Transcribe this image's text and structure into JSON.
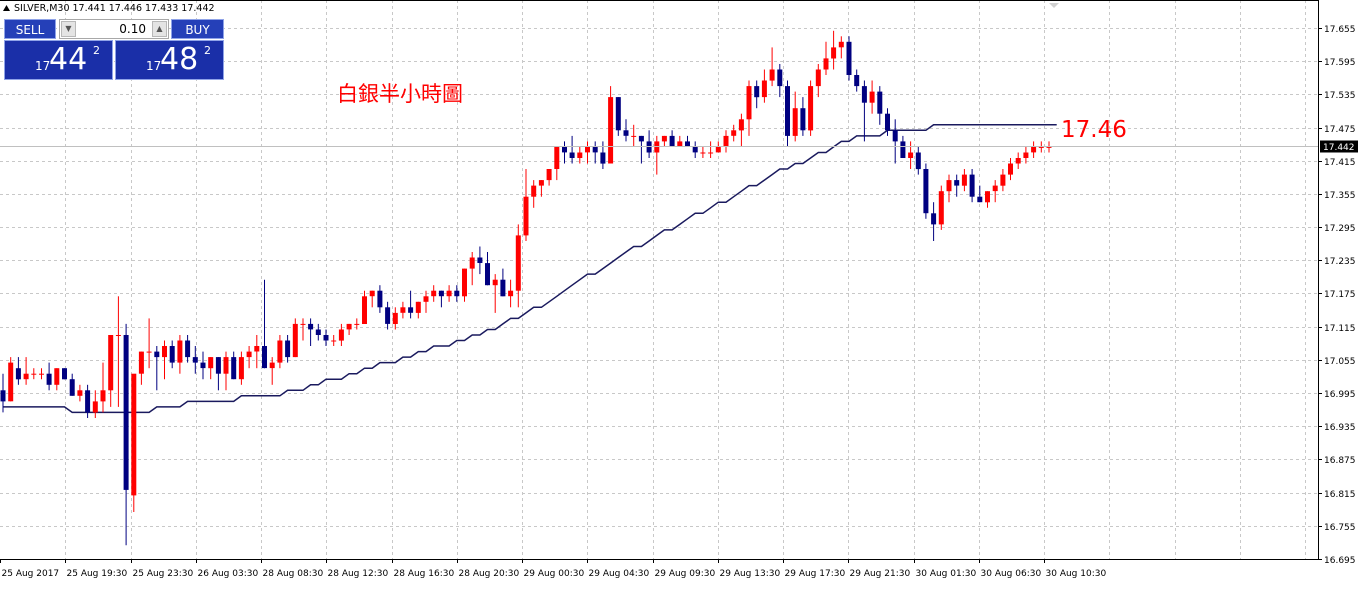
{
  "header": {
    "symbol_line": "SILVER,M30  17.441 17.446 17.433 17.442"
  },
  "trade_panel": {
    "sell_label": "SELL",
    "buy_label": "BUY",
    "lot_value": "0.10",
    "sell_quote": {
      "prefix": "17",
      "big": "44",
      "sup": "2"
    },
    "buy_quote": {
      "prefix": "17",
      "big": "48",
      "sup": "2"
    }
  },
  "annotations": {
    "chart_label": "白銀半小時圖",
    "level_label": "17.46"
  },
  "colors": {
    "bull": "#ff0000",
    "bear": "#000080",
    "ma_line": "#1a1a5e",
    "grid": "#c8c8c8",
    "annotation": "#ff0000",
    "current_price_bg": "#000000"
  },
  "chart_data": {
    "type": "candlestick",
    "title": "SILVER,M30",
    "ylim": [
      16.695,
      17.685
    ],
    "y_ticks": [
      "17.655",
      "17.595",
      "17.535",
      "17.475",
      "17.415",
      "17.355",
      "17.295",
      "17.235",
      "17.175",
      "17.115",
      "17.055",
      "16.995",
      "16.935",
      "16.875",
      "16.815",
      "16.755",
      "16.695"
    ],
    "x_ticks": [
      "25 Aug 2017",
      "25 Aug 19:30",
      "25 Aug 23:30",
      "26 Aug 03:30",
      "28 Aug 08:30",
      "28 Aug 12:30",
      "28 Aug 16:30",
      "28 Aug 20:30",
      "29 Aug 00:30",
      "29 Aug 04:30",
      "29 Aug 09:30",
      "29 Aug 13:30",
      "29 Aug 17:30",
      "29 Aug 21:30",
      "30 Aug 01:30",
      "30 Aug 06:30",
      "30 Aug 10:30"
    ],
    "current_price": 17.442,
    "current_price_label": "17.442",
    "ohlc": [
      [
        17.0,
        17.03,
        16.96,
        16.98
      ],
      [
        16.98,
        17.06,
        16.98,
        17.05
      ],
      [
        17.04,
        17.06,
        17.01,
        17.02
      ],
      [
        17.02,
        17.06,
        17.01,
        17.03
      ],
      [
        17.03,
        17.04,
        17.02,
        17.03
      ],
      [
        17.03,
        17.04,
        17.02,
        17.03
      ],
      [
        17.03,
        17.05,
        17.0,
        17.01
      ],
      [
        17.01,
        17.04,
        17.0,
        17.04
      ],
      [
        17.04,
        17.04,
        17.02,
        17.02
      ],
      [
        17.02,
        17.03,
        16.99,
        16.99
      ],
      [
        16.99,
        17.01,
        16.98,
        17.0
      ],
      [
        17.0,
        17.01,
        16.95,
        16.96
      ],
      [
        16.96,
        17.0,
        16.95,
        16.98
      ],
      [
        16.98,
        17.05,
        16.96,
        17.0
      ],
      [
        17.0,
        17.05,
        16.97,
        17.1
      ],
      [
        17.1,
        17.17,
        16.97,
        17.1
      ],
      [
        17.1,
        17.12,
        16.72,
        16.82
      ],
      [
        16.81,
        17.02,
        16.78,
        17.03
      ],
      [
        17.03,
        17.07,
        17.01,
        17.07
      ],
      [
        17.07,
        17.13,
        17.04,
        17.07
      ],
      [
        17.07,
        17.08,
        17.0,
        17.06
      ],
      [
        17.06,
        17.09,
        17.02,
        17.08
      ],
      [
        17.08,
        17.09,
        17.04,
        17.05
      ],
      [
        17.05,
        17.1,
        17.03,
        17.09
      ],
      [
        17.09,
        17.1,
        17.05,
        17.06
      ],
      [
        17.06,
        17.08,
        17.03,
        17.05
      ],
      [
        17.05,
        17.07,
        17.02,
        17.04
      ],
      [
        17.04,
        17.06,
        17.02,
        17.06
      ],
      [
        17.06,
        17.06,
        17.0,
        17.03
      ],
      [
        17.03,
        17.07,
        17.0,
        17.06
      ],
      [
        17.06,
        17.07,
        17.02,
        17.02
      ],
      [
        17.02,
        17.07,
        17.01,
        17.06
      ],
      [
        17.06,
        17.08,
        17.04,
        17.07
      ],
      [
        17.07,
        17.1,
        17.04,
        17.08
      ],
      [
        17.08,
        17.2,
        17.04,
        17.04
      ],
      [
        17.04,
        17.06,
        17.01,
        17.05
      ],
      [
        17.05,
        17.1,
        17.04,
        17.09
      ],
      [
        17.09,
        17.1,
        17.05,
        17.06
      ],
      [
        17.06,
        17.13,
        17.06,
        17.12
      ],
      [
        17.12,
        17.13,
        17.09,
        17.12
      ],
      [
        17.12,
        17.13,
        17.08,
        17.11
      ],
      [
        17.11,
        17.12,
        17.09,
        17.1
      ],
      [
        17.1,
        17.11,
        17.08,
        17.09
      ],
      [
        17.09,
        17.1,
        17.08,
        17.09
      ],
      [
        17.09,
        17.12,
        17.08,
        17.11
      ],
      [
        17.11,
        17.12,
        17.1,
        17.12
      ],
      [
        17.12,
        17.13,
        17.11,
        17.12
      ],
      [
        17.12,
        17.18,
        17.12,
        17.17
      ],
      [
        17.17,
        17.18,
        17.15,
        17.18
      ],
      [
        17.18,
        17.19,
        17.14,
        17.15
      ],
      [
        17.15,
        17.16,
        17.11,
        17.12
      ],
      [
        17.12,
        17.15,
        17.11,
        17.14
      ],
      [
        17.14,
        17.16,
        17.13,
        17.15
      ],
      [
        17.15,
        17.18,
        17.13,
        17.14
      ],
      [
        17.14,
        17.16,
        17.13,
        17.16
      ],
      [
        17.16,
        17.18,
        17.14,
        17.17
      ],
      [
        17.17,
        17.19,
        17.16,
        17.18
      ],
      [
        17.18,
        17.18,
        17.15,
        17.17
      ],
      [
        17.17,
        17.19,
        17.16,
        17.18
      ],
      [
        17.18,
        17.19,
        17.16,
        17.17
      ],
      [
        17.17,
        17.22,
        17.16,
        17.22
      ],
      [
        17.22,
        17.25,
        17.19,
        17.24
      ],
      [
        17.24,
        17.26,
        17.21,
        17.23
      ],
      [
        17.23,
        17.25,
        17.19,
        17.19
      ],
      [
        17.19,
        17.21,
        17.14,
        17.2
      ],
      [
        17.2,
        17.22,
        17.17,
        17.17
      ],
      [
        17.17,
        17.2,
        17.15,
        17.18
      ],
      [
        17.18,
        17.3,
        17.15,
        17.28
      ],
      [
        17.28,
        17.4,
        17.27,
        17.35
      ],
      [
        17.35,
        17.38,
        17.33,
        17.37
      ],
      [
        17.37,
        17.38,
        17.35,
        17.38
      ],
      [
        17.38,
        17.4,
        17.37,
        17.4
      ],
      [
        17.4,
        17.44,
        17.38,
        17.44
      ],
      [
        17.44,
        17.45,
        17.41,
        17.43
      ],
      [
        17.43,
        17.46,
        17.41,
        17.42
      ],
      [
        17.42,
        17.44,
        17.41,
        17.43
      ],
      [
        17.43,
        17.45,
        17.41,
        17.44
      ],
      [
        17.44,
        17.45,
        17.41,
        17.43
      ],
      [
        17.43,
        17.45,
        17.4,
        17.41
      ],
      [
        17.41,
        17.55,
        17.41,
        17.53
      ],
      [
        17.53,
        17.53,
        17.46,
        17.47
      ],
      [
        17.47,
        17.49,
        17.45,
        17.46
      ],
      [
        17.46,
        17.48,
        17.44,
        17.46
      ],
      [
        17.46,
        17.46,
        17.41,
        17.45
      ],
      [
        17.45,
        17.47,
        17.42,
        17.43
      ],
      [
        17.43,
        17.46,
        17.39,
        17.45
      ],
      [
        17.45,
        17.46,
        17.44,
        17.46
      ],
      [
        17.46,
        17.47,
        17.44,
        17.44
      ],
      [
        17.44,
        17.46,
        17.44,
        17.45
      ],
      [
        17.45,
        17.46,
        17.44,
        17.44
      ],
      [
        17.44,
        17.45,
        17.42,
        17.43
      ],
      [
        17.43,
        17.44,
        17.42,
        17.43
      ],
      [
        17.43,
        17.45,
        17.42,
        17.43
      ],
      [
        17.43,
        17.45,
        17.43,
        17.44
      ],
      [
        17.44,
        17.47,
        17.43,
        17.46
      ],
      [
        17.46,
        17.48,
        17.45,
        17.47
      ],
      [
        17.47,
        17.5,
        17.44,
        17.49
      ],
      [
        17.49,
        17.56,
        17.46,
        17.55
      ],
      [
        17.55,
        17.56,
        17.51,
        17.53
      ],
      [
        17.53,
        17.58,
        17.52,
        17.56
      ],
      [
        17.56,
        17.62,
        17.55,
        17.58
      ],
      [
        17.58,
        17.59,
        17.53,
        17.55
      ],
      [
        17.55,
        17.56,
        17.44,
        17.46
      ],
      [
        17.46,
        17.54,
        17.45,
        17.51
      ],
      [
        17.51,
        17.53,
        17.46,
        17.47
      ],
      [
        17.47,
        17.56,
        17.46,
        17.55
      ],
      [
        17.55,
        17.59,
        17.53,
        17.58
      ],
      [
        17.58,
        17.63,
        17.57,
        17.6
      ],
      [
        17.6,
        17.65,
        17.58,
        17.62
      ],
      [
        17.62,
        17.64,
        17.6,
        17.63
      ],
      [
        17.63,
        17.64,
        17.56,
        17.57
      ],
      [
        17.57,
        17.58,
        17.54,
        17.55
      ],
      [
        17.55,
        17.56,
        17.45,
        17.52
      ],
      [
        17.52,
        17.56,
        17.5,
        17.54
      ],
      [
        17.54,
        17.55,
        17.48,
        17.5
      ],
      [
        17.5,
        17.51,
        17.46,
        17.47
      ],
      [
        17.47,
        17.49,
        17.41,
        17.45
      ],
      [
        17.45,
        17.46,
        17.42,
        17.42
      ],
      [
        17.42,
        17.45,
        17.4,
        17.43
      ],
      [
        17.43,
        17.44,
        17.39,
        17.4
      ],
      [
        17.4,
        17.41,
        17.31,
        17.32
      ],
      [
        17.32,
        17.34,
        17.27,
        17.3
      ],
      [
        17.3,
        17.37,
        17.29,
        17.36
      ],
      [
        17.36,
        17.39,
        17.34,
        17.38
      ],
      [
        17.38,
        17.39,
        17.35,
        17.37
      ],
      [
        17.37,
        17.4,
        17.36,
        17.39
      ],
      [
        17.39,
        17.4,
        17.34,
        17.35
      ],
      [
        17.35,
        17.37,
        17.34,
        17.34
      ],
      [
        17.34,
        17.36,
        17.33,
        17.36
      ],
      [
        17.36,
        17.38,
        17.34,
        17.37
      ],
      [
        17.37,
        17.4,
        17.36,
        17.39
      ],
      [
        17.39,
        17.42,
        17.38,
        17.41
      ],
      [
        17.41,
        17.43,
        17.4,
        17.42
      ],
      [
        17.42,
        17.44,
        17.41,
        17.43
      ],
      [
        17.43,
        17.45,
        17.42,
        17.44
      ],
      [
        17.44,
        17.45,
        17.43,
        17.44
      ],
      [
        17.44,
        17.45,
        17.43,
        17.44
      ]
    ],
    "ma": [
      16.97,
      16.97,
      16.97,
      16.97,
      16.97,
      16.97,
      16.97,
      16.97,
      16.97,
      16.96,
      16.96,
      16.96,
      16.96,
      16.96,
      16.96,
      16.96,
      16.96,
      16.96,
      16.96,
      16.96,
      16.97,
      16.97,
      16.97,
      16.97,
      16.98,
      16.98,
      16.98,
      16.98,
      16.98,
      16.98,
      16.98,
      16.99,
      16.99,
      16.99,
      16.99,
      16.99,
      16.99,
      17.0,
      17.0,
      17.0,
      17.01,
      17.01,
      17.02,
      17.02,
      17.02,
      17.03,
      17.03,
      17.04,
      17.04,
      17.05,
      17.05,
      17.05,
      17.06,
      17.06,
      17.07,
      17.07,
      17.08,
      17.08,
      17.08,
      17.09,
      17.09,
      17.1,
      17.1,
      17.11,
      17.11,
      17.12,
      17.13,
      17.13,
      17.14,
      17.15,
      17.15,
      17.16,
      17.17,
      17.18,
      17.19,
      17.2,
      17.21,
      17.21,
      17.22,
      17.23,
      17.24,
      17.25,
      17.26,
      17.26,
      17.27,
      17.28,
      17.29,
      17.29,
      17.3,
      17.31,
      17.32,
      17.32,
      17.33,
      17.34,
      17.34,
      17.35,
      17.36,
      17.37,
      17.37,
      17.38,
      17.39,
      17.4,
      17.4,
      17.41,
      17.41,
      17.42,
      17.43,
      17.43,
      17.44,
      17.45,
      17.45,
      17.46,
      17.46,
      17.46,
      17.46,
      17.47,
      17.47,
      17.47,
      17.47,
      17.47,
      17.47,
      17.48,
      17.48,
      17.48,
      17.48,
      17.48,
      17.48,
      17.48,
      17.48,
      17.48,
      17.48,
      17.48,
      17.48,
      17.48,
      17.48,
      17.48,
      17.48,
      17.48
    ]
  }
}
